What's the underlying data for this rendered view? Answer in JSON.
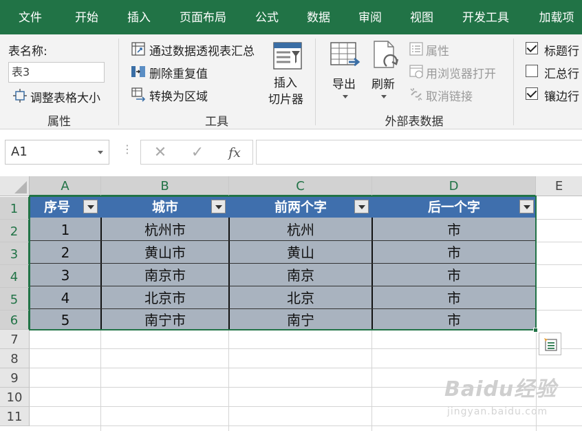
{
  "tabs": [
    "文件",
    "开始",
    "插入",
    "页面布局",
    "公式",
    "数据",
    "审阅",
    "视图",
    "开发工具",
    "加载项"
  ],
  "ribbon": {
    "properties": {
      "table_name_label": "表名称:",
      "table_name_value": "表3",
      "resize_label": "调整表格大小",
      "group_label": "属性"
    },
    "tools": {
      "pivot_label": "通过数据透视表汇总",
      "remove_dup_label": "删除重复值",
      "convert_label": "转换为区域",
      "slicer_line1": "插入",
      "slicer_line2": "切片器",
      "group_label": "工具"
    },
    "external": {
      "export_label": "导出",
      "refresh_label": "刷新",
      "properties_label": "属性",
      "open_browser_label": "用浏览器打开",
      "unlink_label": "取消链接",
      "group_label": "外部表数据"
    },
    "style_options": {
      "header_row_label": "标题行",
      "header_row_checked": true,
      "total_row_label": "汇总行",
      "total_row_checked": false,
      "banded_rows_label": "镶边行",
      "banded_rows_checked": true
    }
  },
  "formula_bar": {
    "name_box": "A1",
    "cancel_glyph": "✕",
    "enter_glyph": "✓",
    "fx_label": "fx",
    "formula": ""
  },
  "sheet": {
    "columns": [
      "A",
      "B",
      "C",
      "D",
      "E"
    ],
    "rows": [
      "1",
      "2",
      "3",
      "4",
      "5",
      "6",
      "7",
      "8",
      "9",
      "10",
      "11"
    ],
    "table_headers": [
      "序号",
      "城市",
      "前两个字",
      "后一个字"
    ],
    "table_rows": [
      [
        "1",
        "杭州市",
        "杭州",
        "市"
      ],
      [
        "2",
        "黄山市",
        "黄山",
        "市"
      ],
      [
        "3",
        "南京市",
        "南京",
        "市"
      ],
      [
        "4",
        "北京市",
        "北京",
        "市"
      ],
      [
        "5",
        "南宁市",
        "南宁",
        "市"
      ]
    ]
  },
  "watermark": {
    "main": "Baidu经验",
    "sub": "jingyan.baidu.com"
  },
  "colors": {
    "excel_green": "#217346",
    "table_header": "#3f6fad",
    "table_row": "#a9b3bf"
  }
}
